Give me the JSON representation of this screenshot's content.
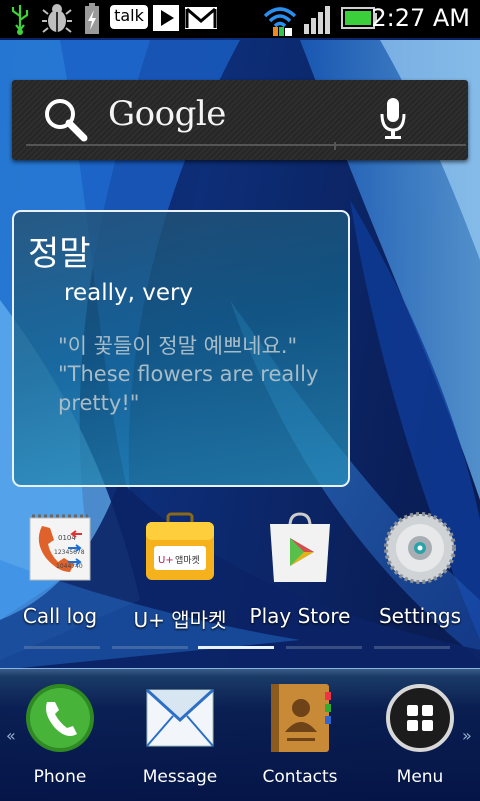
{
  "status_bar": {
    "time": "2:27 AM",
    "talk_label": "talk",
    "icons": [
      "usb-icon",
      "bug-icon",
      "battery-charging-icon",
      "talk-icon",
      "play-store-notification-icon",
      "gmail-icon",
      "wifi-icon",
      "signal-icon",
      "battery-icon"
    ]
  },
  "search_widget": {
    "label": "Google"
  },
  "dictionary_widget": {
    "word": "정말",
    "meaning": "really, very",
    "example_korean": "\"이 꽃들이 정말 예쁘네요.\"",
    "example_english": "\"These flowers are really pretty!\""
  },
  "apps": [
    {
      "label": "Call log",
      "icon": "call-log-icon"
    },
    {
      "label": "U+ 앱마켓",
      "icon": "uplus-app-market-icon",
      "icon_text": "앱마켓"
    },
    {
      "label": "Play Store",
      "icon": "play-store-icon"
    },
    {
      "label": "Settings",
      "icon": "settings-icon"
    }
  ],
  "page_indicator": {
    "count": 6,
    "active_index": 2
  },
  "dock": [
    {
      "label": "Phone",
      "icon": "phone-icon"
    },
    {
      "label": "Message",
      "icon": "message-icon"
    },
    {
      "label": "Contacts",
      "icon": "contacts-icon"
    },
    {
      "label": "Menu",
      "icon": "app-drawer-icon"
    }
  ],
  "colors": {
    "wallpaper_dark": "#06113a",
    "wallpaper_light": "#2f8fe0",
    "phone_green": "#3aa52a",
    "accent_white": "#eaf2ff"
  }
}
